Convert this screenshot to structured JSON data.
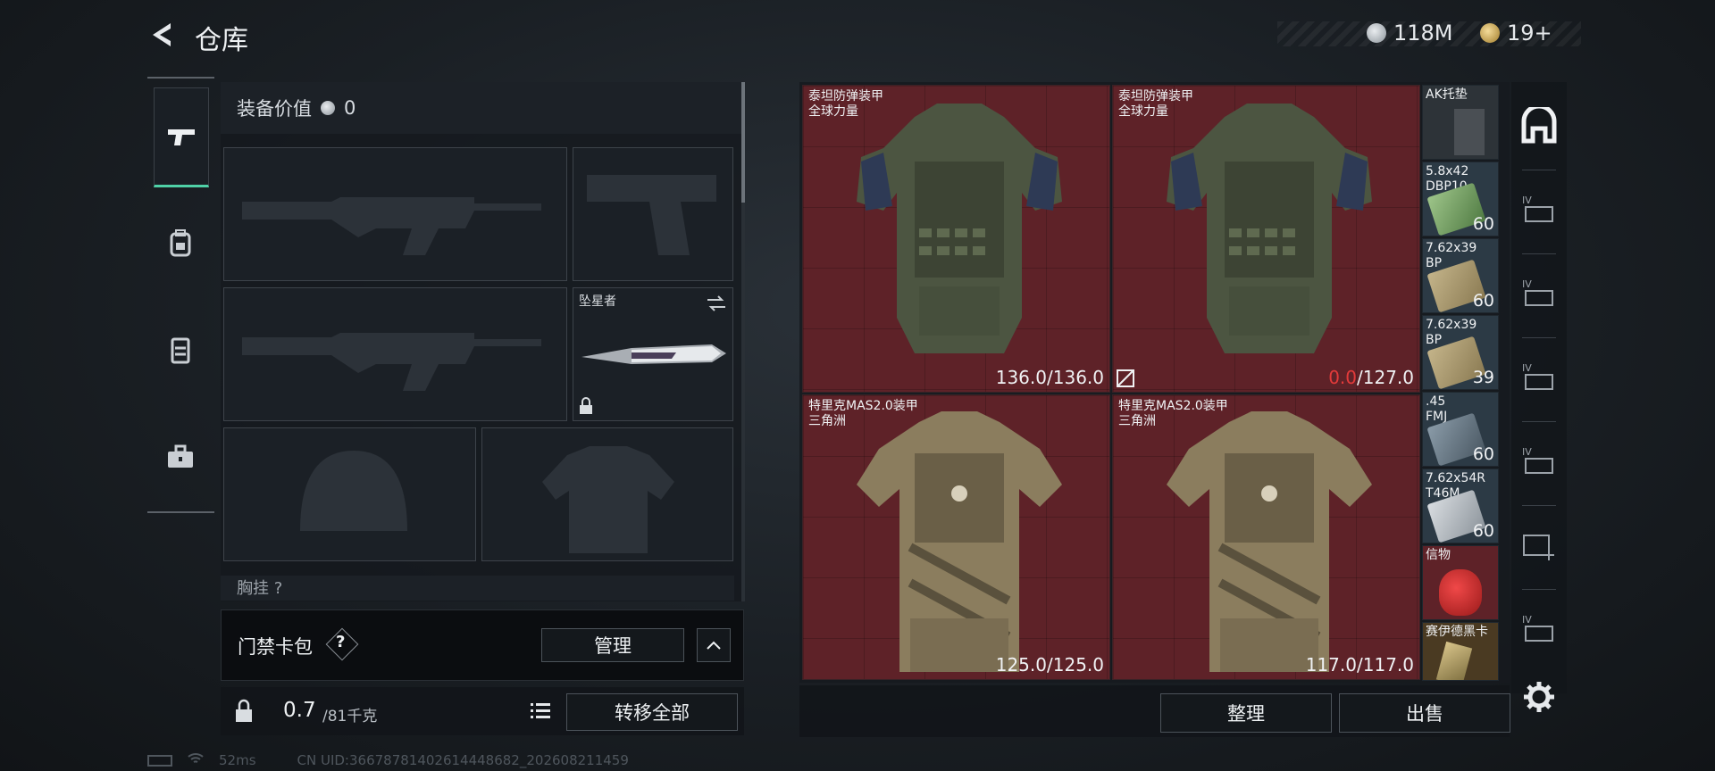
{
  "header": {
    "title": "仓库",
    "currency_silver": "118M",
    "currency_gold": "19+"
  },
  "equipment": {
    "value_label": "装备价值",
    "value": "0",
    "melee_slot_label": "坠星者",
    "partial_section_label": "胸挂 ?"
  },
  "keycard": {
    "label": "门禁卡包",
    "help": "?",
    "manage_label": "管理"
  },
  "weight": {
    "current": "0.7",
    "max_unit": "/81千克",
    "transfer_all_label": "转移全部"
  },
  "inventory": {
    "items": [
      {
        "name": "泰坦防弹装甲\n全球力量",
        "durability_current": "136.0",
        "durability_max": "/136.0",
        "broken": false
      },
      {
        "name": "泰坦防弹装甲\n全球力量",
        "durability_current": "0.0",
        "durability_max": "/127.0",
        "broken": true
      },
      {
        "name": "特里克MAS2.0装甲\n三角洲",
        "durability_current": "125.0",
        "durability_max": "/125.0",
        "broken": false
      },
      {
        "name": "特里克MAS2.0装甲\n三角洲",
        "durability_current": "117.0",
        "durability_max": "/117.0",
        "broken": false
      }
    ],
    "small_items": [
      {
        "name": "AK托垫",
        "qty": ""
      },
      {
        "name": "5.8x42\nDBP10",
        "qty": "60"
      },
      {
        "name": "7.62x39\nBP",
        "qty": "60"
      },
      {
        "name": "7.62x39\nBP",
        "qty": "39"
      },
      {
        "name": ".45\nFMJ",
        "qty": "60"
      },
      {
        "name": "7.62x54R\nT46M",
        "qty": "60"
      },
      {
        "name": "信物",
        "qty": ""
      },
      {
        "name": "赛伊德黑卡",
        "qty": ""
      }
    ],
    "sort_label": "整理",
    "sell_label": "出售"
  },
  "status": {
    "ping": "52ms",
    "uid": "CN UID:3667878140261444868​2_202608211459"
  },
  "colors": {
    "accent_green": "#4fd1a7",
    "cell_red": "#5e2228",
    "broken_red": "#e23a3a"
  }
}
